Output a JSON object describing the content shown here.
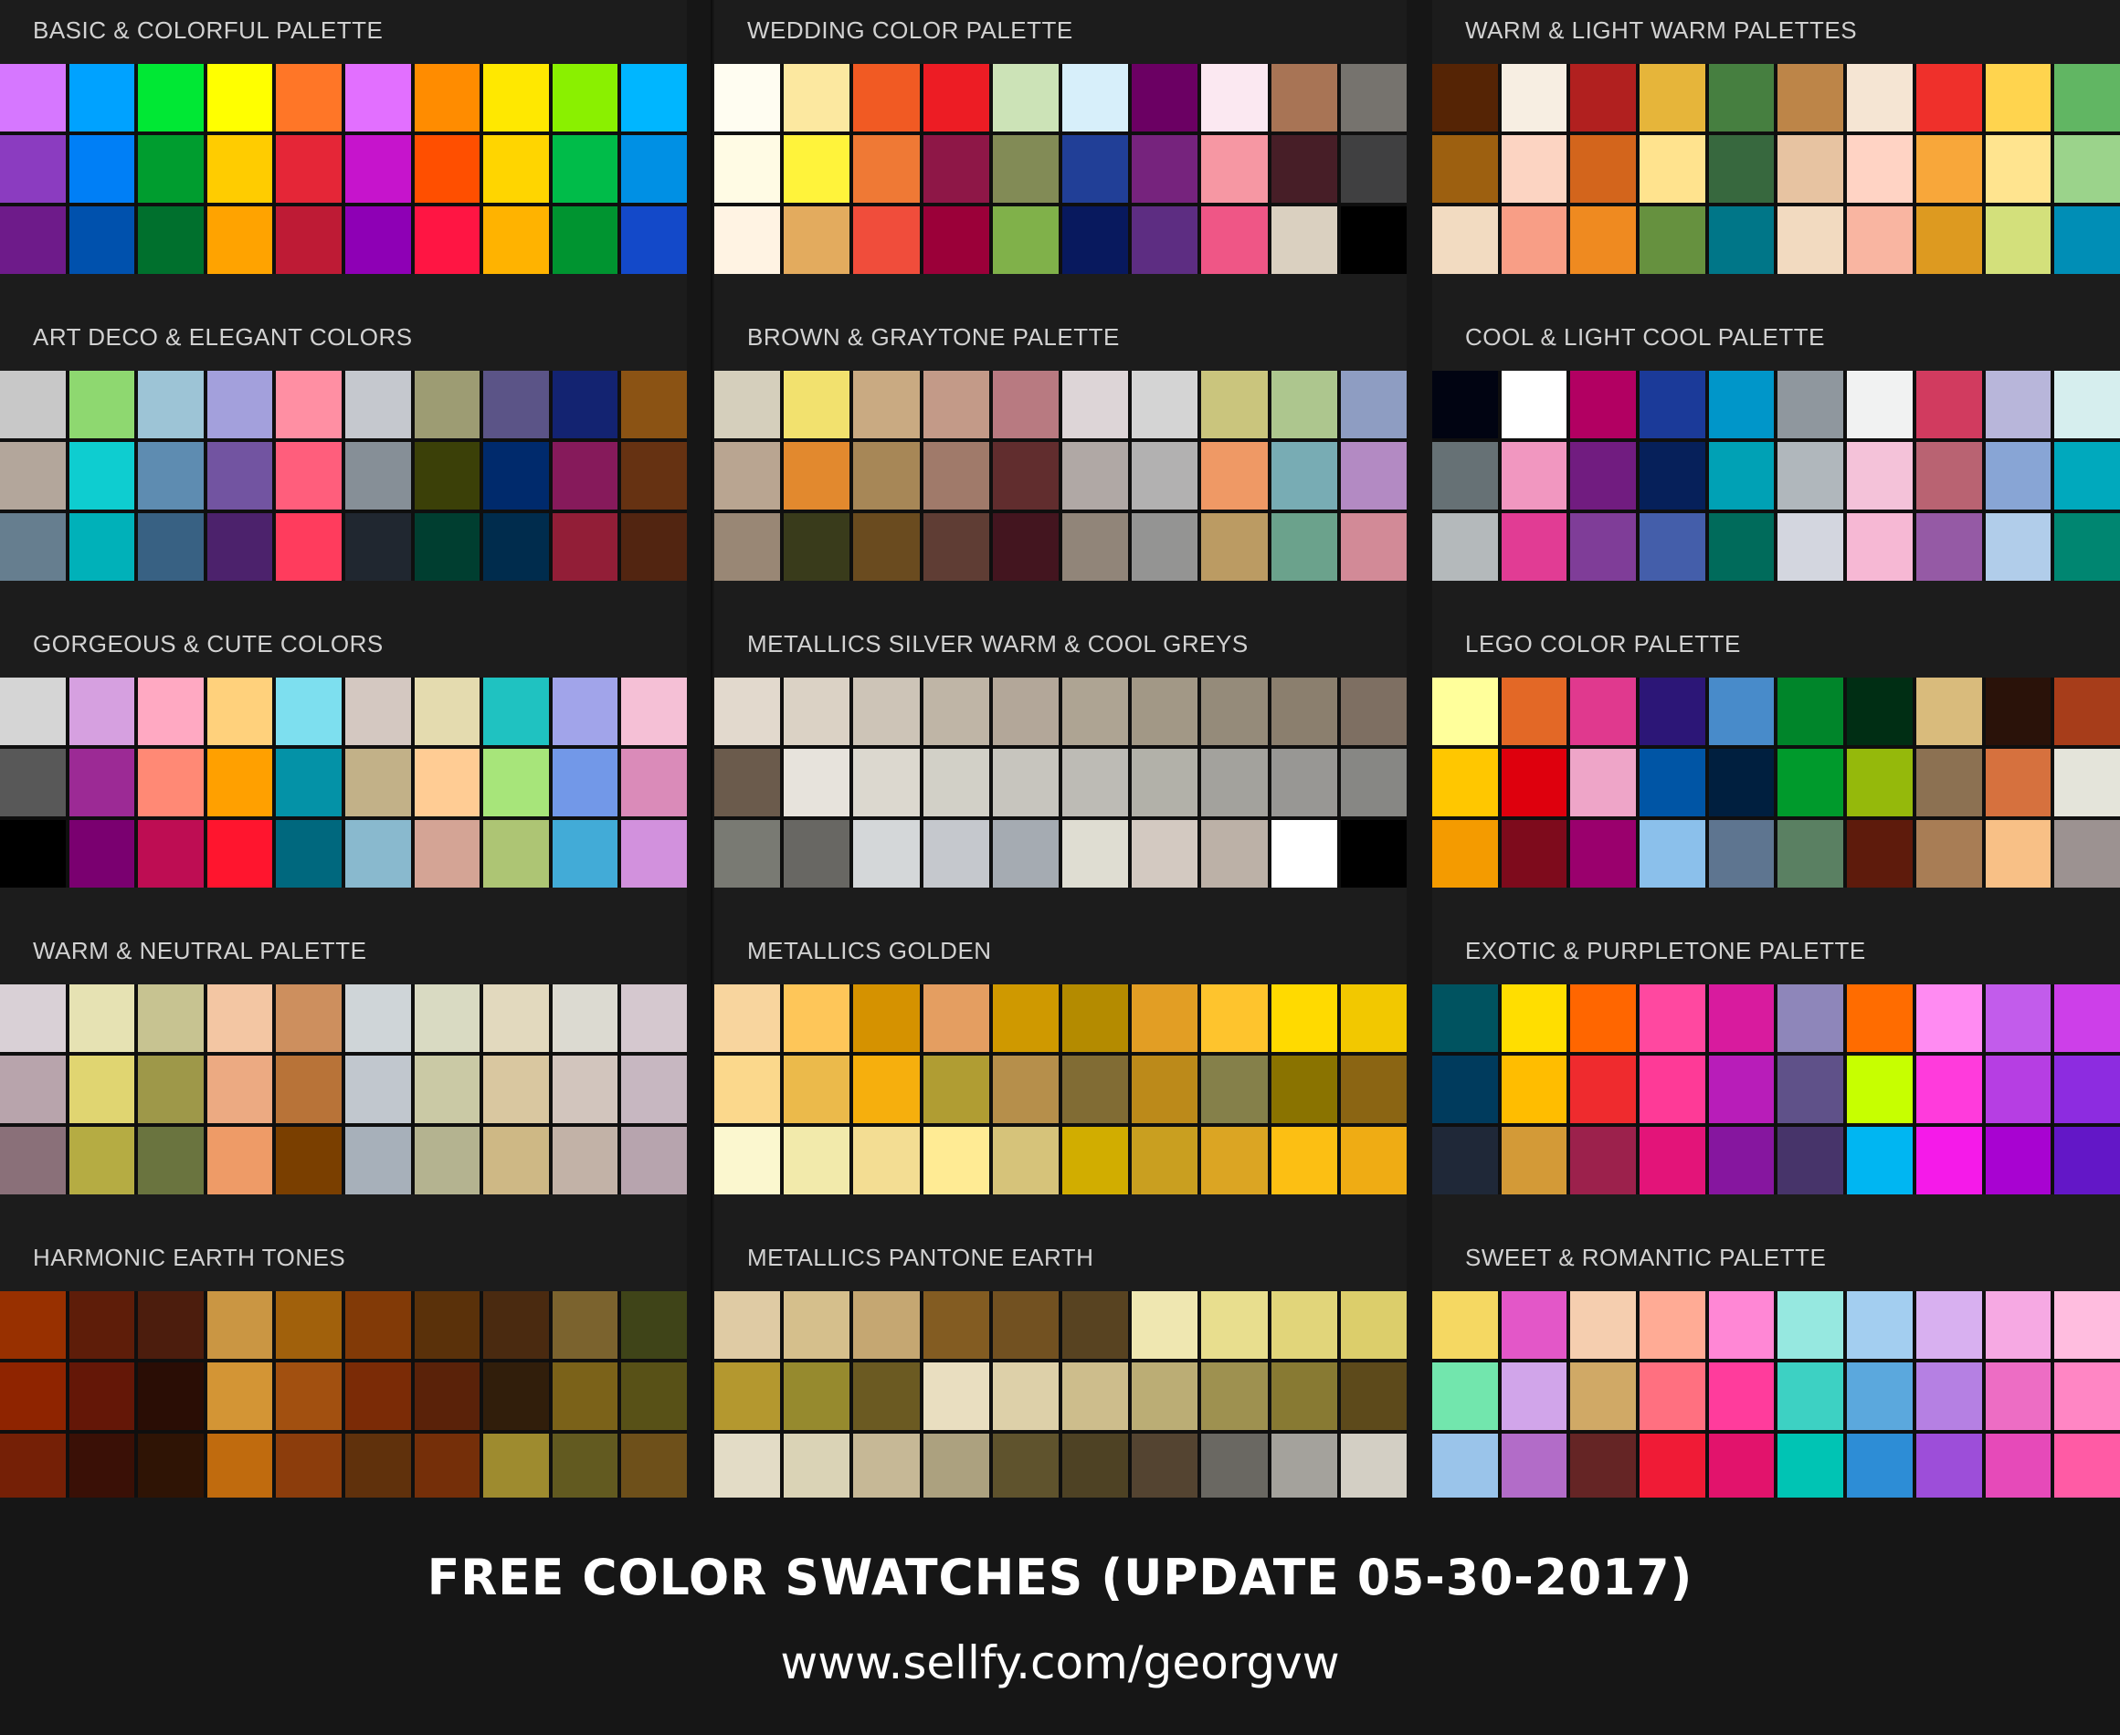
{
  "footer": {
    "title": "FREE COLOR SWATCHES (UPDATE 05-30-2017)",
    "url": "www.sellfy.com/georgvw"
  },
  "palettes": [
    {
      "title": "BASIC & COLORFUL PALETTE",
      "colors": [
        "#d677ff",
        "#00a2ff",
        "#00e834",
        "#ffff00",
        "#ff7627",
        "#e26fff",
        "#ff8c00",
        "#ffe800",
        "#8af000",
        "#00b6ff",
        "#8b3cc0",
        "#007ff6",
        "#009d2f",
        "#ffcc00",
        "#e52637",
        "#c614cc",
        "#ff4f00",
        "#ffd500",
        "#00bc49",
        "#0090e4",
        "#6e1b8a",
        "#0051ad",
        "#00702d",
        "#ffa300",
        "#be1b35",
        "#8e00b5",
        "#ff1543",
        "#ffb300",
        "#009430",
        "#1349c9"
      ]
    },
    {
      "title": "ART DECO & ELEGANT COLORS",
      "colors": [
        "#c8c8c8",
        "#8ed870",
        "#9dc4d6",
        "#a3a0dc",
        "#ff8fa3",
        "#c5c8ce",
        "#9d9c73",
        "#5b5487",
        "#132371",
        "#8b5314",
        "#b3a69b",
        "#0ecdd0",
        "#5e8cb1",
        "#7254a1",
        "#ff5e7c",
        "#868f97",
        "#3b4008",
        "#002a6c",
        "#861a5b",
        "#663212",
        "#667e8f",
        "#00b1b9",
        "#386183",
        "#4c226c",
        "#ff3c5d",
        "#202730",
        "#003e30",
        "#002c4d",
        "#921e37",
        "#522511"
      ]
    },
    {
      "title": "GORGEOUS & CUTE COLORS",
      "colors": [
        "#d5d5d5",
        "#d6a0e0",
        "#ffa9c2",
        "#ffd17c",
        "#7ddfef",
        "#d4c8c1",
        "#e4dbaf",
        "#1fc2c1",
        "#a1a4ea",
        "#f5c0d6",
        "#585858",
        "#9c2a95",
        "#ff8975",
        "#ffa000",
        "#0492a7",
        "#c2b188",
        "#ffcc94",
        "#a7e57a",
        "#7298e8",
        "#da8bb9",
        "#000000",
        "#7a0070",
        "#be0d53",
        "#ff152e",
        "#00687e",
        "#89b9ce",
        "#d4a495",
        "#adc574",
        "#42abd7",
        "#d291dd"
      ]
    },
    {
      "title": "WARM & NEUTRAL PALETTE",
      "colors": [
        "#d9d0d6",
        "#e6e2b3",
        "#c7c391",
        "#f3c6a3",
        "#cd8f5e",
        "#cfd5d8",
        "#d9dac2",
        "#e2d9be",
        "#dcdad1",
        "#d5c8cf",
        "#b8a4ac",
        "#e0d571",
        "#9e9849",
        "#ecaa82",
        "#b87338",
        "#c1c7ce",
        "#cac9a5",
        "#d9c7a0",
        "#d2c5bd",
        "#c7b7c1",
        "#8a7079",
        "#b5ac43",
        "#6a743f",
        "#ee9b67",
        "#7a3f00",
        "#a7b0ba",
        "#b4b390",
        "#ceb885",
        "#c2b2a7",
        "#b7a4ae"
      ]
    },
    {
      "title": "HARMONIC EARTH TONES",
      "colors": [
        "#983000",
        "#5e1d09",
        "#4c1d0d",
        "#ca9643",
        "#a1610c",
        "#823a07",
        "#5a310a",
        "#4a2a10",
        "#7b632e",
        "#3f4418",
        "#8f2400",
        "#641707",
        "#2a0d05",
        "#d39535",
        "#a25010",
        "#7b2b06",
        "#5a2209",
        "#311e0b",
        "#7b6219",
        "#585117",
        "#752006",
        "#3a1006",
        "#2f1405",
        "#c06b0e",
        "#8c3d0c",
        "#60310c",
        "#752f09",
        "#9e8b2f",
        "#625a20",
        "#6e501a"
      ]
    },
    {
      "title": "WEDDING COLOR PALETTE",
      "colors": [
        "#fffdf1",
        "#fce8a0",
        "#f15a23",
        "#ed1c24",
        "#cce3b7",
        "#d7effa",
        "#6b0063",
        "#fbe8f1",
        "#a87455",
        "#76736e",
        "#fffbe4",
        "#fff33b",
        "#ef7935",
        "#8e1747",
        "#828b56",
        "#213f97",
        "#76237d",
        "#f697a3",
        "#471e27",
        "#404041",
        "#fff3e3",
        "#e3ab5e",
        "#f04d3b",
        "#9b0039",
        "#80b14a",
        "#08195e",
        "#5d2d82",
        "#ef5686",
        "#dad0c0",
        "#000000"
      ]
    },
    {
      "title": "BROWN & GRAYTONE PALETTE",
      "colors": [
        "#d5cfbc",
        "#f2e16e",
        "#c9aa82",
        "#c39a88",
        "#b87a81",
        "#ddd5d7",
        "#d4d4d4",
        "#cac57d",
        "#adc68e",
        "#8e9dc2",
        "#b9a591",
        "#e2892e",
        "#a78757",
        "#a07a6a",
        "#612d2e",
        "#b0a8a5",
        "#b2b1b1",
        "#ef9965",
        "#78acb4",
        "#b38ac3",
        "#998775",
        "#393b1b",
        "#6a4b1f",
        "#5f3d34",
        "#43151f",
        "#918579",
        "#949493",
        "#bb9b63",
        "#6ba28c",
        "#d28a97"
      ]
    },
    {
      "title": "METALLICS SILVER WARM & COOL GREYS",
      "colors": [
        "#e2d9cd",
        "#dbd2c5",
        "#cdc4b7",
        "#bfb5a6",
        "#b3a799",
        "#aea493",
        "#a29886",
        "#958b7a",
        "#8b7f6e",
        "#7e6f62",
        "#6b5b4c",
        "#e7e3dc",
        "#dcd8cf",
        "#d2d0c7",
        "#c7c5be",
        "#bdbbb5",
        "#b2b1a9",
        "#a3a29d",
        "#989794",
        "#878784",
        "#797a73",
        "#686763",
        "#d4d7d9",
        "#c5c8cd",
        "#a5abb2",
        "#dfddd2",
        "#d3c9c1",
        "#bcb1a7",
        "#ffffff",
        "#000000"
      ]
    },
    {
      "title": "METALLICS GOLDEN",
      "colors": [
        "#f8d59e",
        "#fec659",
        "#d59200",
        "#e49e61",
        "#cf9900",
        "#b48b00",
        "#e29e24",
        "#fec42d",
        "#ffda00",
        "#f2c800",
        "#fbd88c",
        "#ebba4b",
        "#f6af0d",
        "#b09d33",
        "#b68f4b",
        "#816c34",
        "#bc8a1a",
        "#85804a",
        "#8a7300",
        "#8b6513",
        "#fbf7cf",
        "#f2eaab",
        "#f3dd93",
        "#ffeb94",
        "#d6c37a",
        "#d1ad00",
        "#c99f20",
        "#dba523",
        "#fcbf13",
        "#efac14"
      ]
    },
    {
      "title": "METALLICS PANTONE EARTH",
      "colors": [
        "#dfcba4",
        "#d5bf8c",
        "#c5a772",
        "#835c22",
        "#725121",
        "#584321",
        "#efe7b1",
        "#e8de8e",
        "#e1d57a",
        "#dcce6b",
        "#b4982f",
        "#968a2e",
        "#6b5a22",
        "#e9dec0",
        "#ddd0a9",
        "#cdbd8c",
        "#bbad75",
        "#9e9150",
        "#887a33",
        "#5d4a1b",
        "#e3dcc6",
        "#dad3b6",
        "#c6b896",
        "#aca17f",
        "#5f532d",
        "#4e4224",
        "#544431",
        "#6a6862",
        "#a4a29c",
        "#d3cfc4"
      ]
    },
    {
      "title": "WARM & LIGHT WARM PALETTES",
      "colors": [
        "#552405",
        "#f7eee2",
        "#b1201f",
        "#e6b53a",
        "#467f40",
        "#bd8548",
        "#f5e5d3",
        "#ef302b",
        "#ffd44e",
        "#61b663",
        "#9d6010",
        "#fcd4c2",
        "#d3651c",
        "#ffe38e",
        "#37683e",
        "#e7c3a1",
        "#ffd3c4",
        "#f8a73a",
        "#ffe48f",
        "#9bd38b",
        "#f2dbc1",
        "#f89e86",
        "#ef8a20",
        "#66913f",
        "#007688",
        "#f2dac0",
        "#f9b5a1",
        "#dd9a20",
        "#d3e07b",
        "#008eb6"
      ]
    },
    {
      "title": "COOL & LIGHT COOL PALETTE",
      "colors": [
        "#010412",
        "#ffffff",
        "#b20062",
        "#1b3a99",
        "#0096c9",
        "#8f979e",
        "#f1f2f2",
        "#d13b5f",
        "#b8b6da",
        "#d6eeee",
        "#667175",
        "#f197c0",
        "#711c80",
        "#06205a",
        "#00a1b5",
        "#b0b7bc",
        "#f4c2d9",
        "#b96372",
        "#88a5d5",
        "#00a9bd",
        "#b4b9bb",
        "#e13c94",
        "#7f3d98",
        "#445eaa",
        "#006b5b",
        "#d3d6df",
        "#f6b8d4",
        "#955aa5",
        "#b1cdea",
        "#008671"
      ]
    },
    {
      "title": "LEGO COLOR PALETTE",
      "colors": [
        "#ffff9b",
        "#e36826",
        "#e0398e",
        "#2c1677",
        "#488bca",
        "#00852a",
        "#002e14",
        "#d9bb7c",
        "#2a1209",
        "#a73d1a",
        "#ffc700",
        "#de000d",
        "#eea5c8",
        "#0055a5",
        "#001f3f",
        "#009a2c",
        "#95b90b",
        "#8c7152",
        "#d6713e",
        "#e4e4da",
        "#f49b00",
        "#7e0b1c",
        "#9a006d",
        "#8bc0eb",
        "#5e7590",
        "#5a8062",
        "#5e1b0c",
        "#a87d55",
        "#f8c086",
        "#9c9291"
      ]
    },
    {
      "title": "EXOTIC & PURPLETONE PALETTE",
      "colors": [
        "#005360",
        "#ffde00",
        "#ff6600",
        "#ff48a0",
        "#d81b9e",
        "#8e86ba",
        "#ff6c00",
        "#ff8bf2",
        "#c25ceb",
        "#cd3fe9",
        "#003b5d",
        "#ffbd00",
        "#ef2b2e",
        "#fe3a97",
        "#b81db9",
        "#5f5189",
        "#c7ff00",
        "#ff3bdc",
        "#b63ee3",
        "#8d2ce0",
        "#1f2838",
        "#d39a37",
        "#9c214c",
        "#e31479",
        "#86169f",
        "#47346a",
        "#00b6f2",
        "#f51ae9",
        "#a803d1",
        "#6317c7"
      ]
    },
    {
      "title": "SWEET & ROMANTIC PALETTE",
      "colors": [
        "#f5d862",
        "#e357c8",
        "#f5ceaf",
        "#ffab95",
        "#ff87d5",
        "#96e8e0",
        "#a3cef0",
        "#d8b0f0",
        "#f6a9e3",
        "#ffbddf",
        "#72e6ad",
        "#d1a5ea",
        "#d0a966",
        "#ff7080",
        "#ff3c9c",
        "#3dd1c3",
        "#5ba8dd",
        "#b580e3",
        "#ed6dc4",
        "#ff86c4",
        "#9ac4ea",
        "#b26cc8",
        "#652525",
        "#f01b36",
        "#e2136c",
        "#00c4b4",
        "#2d8dd6",
        "#9d4ed9",
        "#e64ab9",
        "#ff5ba5"
      ]
    }
  ]
}
